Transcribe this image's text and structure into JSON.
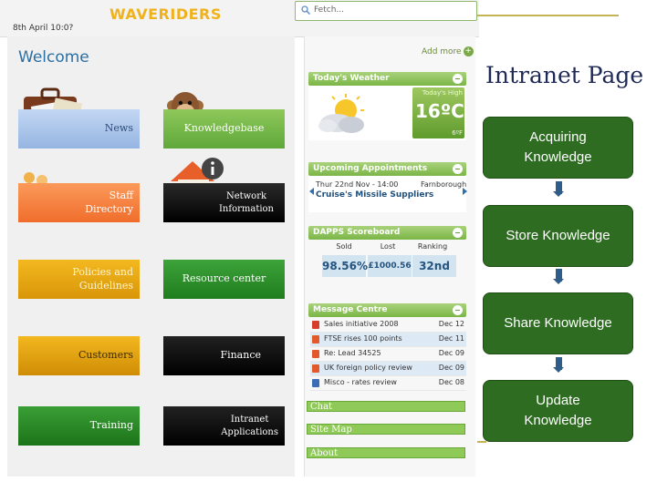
{
  "page_title": "Intranet Page",
  "intranet": {
    "brand": "WAVERIDERS",
    "date": "8th April 10:0?",
    "search_placeholder": "Fetch...",
    "welcome": "Welcome",
    "add_more": "Add more",
    "tiles": [
      {
        "label": "News",
        "color": "#a8c4ea"
      },
      {
        "label": "Knowledgebase",
        "color": "#6db544"
      },
      {
        "label": "Staff\nDirectory",
        "color": "#f47b3a"
      },
      {
        "label": "Network\nInformation",
        "color": "#000000"
      },
      {
        "label": "Policies and\nGuidelines",
        "color": "#e9a40f"
      },
      {
        "label": "Resource center",
        "color": "#2d8e2a"
      },
      {
        "label": "Customers",
        "color": "#e0a00c"
      },
      {
        "label": "Finance",
        "color": "#000000"
      },
      {
        "label": "Training",
        "color": "#2d8e2a"
      },
      {
        "label": "Intranet\nApplications",
        "color": "#000000"
      }
    ],
    "weather": {
      "header": "Today's Weather",
      "high_label": "Today's High",
      "temperature": "16ºC",
      "low": "6ºF"
    },
    "appointments": {
      "header": "Upcoming Appointments",
      "date": "Thur 22nd Nov - 14:00",
      "location": "Farnborough",
      "title": "Cruise's Missile Suppliers"
    },
    "scoreboard": {
      "header": "DAPPS Scoreboard",
      "columns": [
        "Sold",
        "Lost",
        "Ranking"
      ],
      "values": [
        "98.56%",
        "£1000.56",
        "32nd"
      ]
    },
    "messages": {
      "header": "Message Centre",
      "items": [
        {
          "title": "Sales initiative 2008",
          "date": "Dec 12",
          "icon": "pdf-icon"
        },
        {
          "title": "FTSE rises 100 points",
          "date": "Dec 11",
          "icon": "rss-icon"
        },
        {
          "title": "Re: Lead 34525",
          "date": "Dec 09",
          "icon": "rss-icon"
        },
        {
          "title": "UK foreign policy review",
          "date": "Dec 09",
          "icon": "rss-icon"
        },
        {
          "title": "Misco - rates review",
          "date": "Dec 08",
          "icon": "doc-icon"
        }
      ]
    },
    "links": [
      "Chat",
      "Site Map",
      "About"
    ]
  },
  "steps": [
    "Acquiring\nKnowledge",
    "Store Knowledge",
    "Share Knowledge",
    "Update\nKnowledge"
  ],
  "colors": {
    "step_green": "#2e6d21",
    "widget_green": "#8fc257",
    "arrow_blue": "#2e5d8a",
    "brand_yellow": "#f0b21c"
  }
}
